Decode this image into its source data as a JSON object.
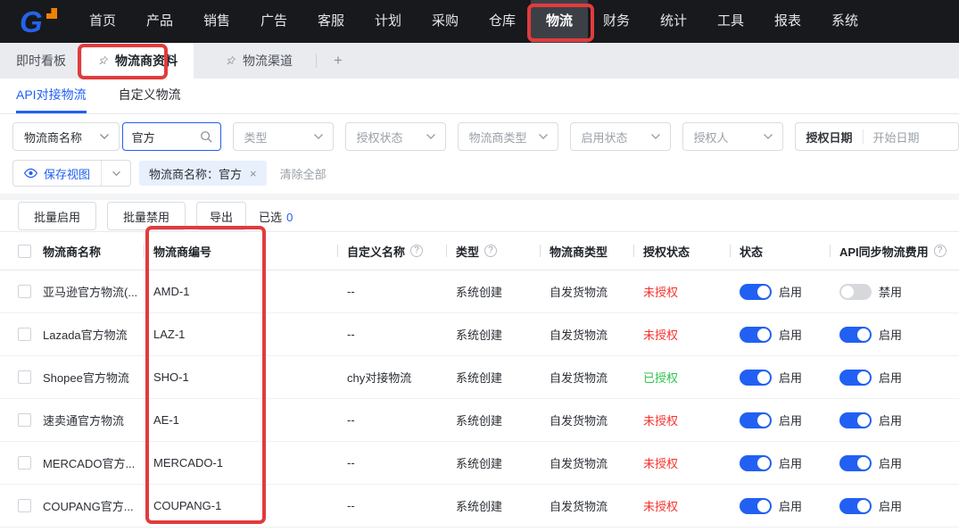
{
  "nav": {
    "logo_text": "G",
    "items": [
      {
        "id": "home",
        "label": "首页",
        "active": false
      },
      {
        "id": "product",
        "label": "产品",
        "active": false
      },
      {
        "id": "sales",
        "label": "销售",
        "active": false
      },
      {
        "id": "ads",
        "label": "广告",
        "active": false
      },
      {
        "id": "service",
        "label": "客服",
        "active": false
      },
      {
        "id": "plan",
        "label": "计划",
        "active": false
      },
      {
        "id": "purchase",
        "label": "采购",
        "active": false
      },
      {
        "id": "warehouse",
        "label": "仓库",
        "active": false
      },
      {
        "id": "logistics",
        "label": "物流",
        "active": true
      },
      {
        "id": "finance",
        "label": "财务",
        "active": false
      },
      {
        "id": "stats",
        "label": "统计",
        "active": false
      },
      {
        "id": "tools",
        "label": "工具",
        "active": false
      },
      {
        "id": "reports",
        "label": "报表",
        "active": false
      },
      {
        "id": "system",
        "label": "系统",
        "active": false
      }
    ]
  },
  "tabs": {
    "items": [
      {
        "id": "dashboard",
        "label": "即时看板",
        "pinned": false,
        "active": false
      },
      {
        "id": "provider-info",
        "label": "物流商资料",
        "pinned": true,
        "active": true
      },
      {
        "id": "channel",
        "label": "物流渠道",
        "pinned": true,
        "active": false
      }
    ],
    "add_label": "+"
  },
  "subtabs": [
    {
      "id": "api-logistics",
      "label": "API对接物流",
      "active": true
    },
    {
      "id": "custom-logistics",
      "label": "自定义物流",
      "active": false
    }
  ],
  "filters": {
    "field_select": "物流商名称",
    "search_value": "官方",
    "selects": [
      {
        "id": "type",
        "placeholder": "类型"
      },
      {
        "id": "auth-status",
        "placeholder": "授权状态"
      },
      {
        "id": "provider-type",
        "placeholder": "物流商类型"
      },
      {
        "id": "enable-status",
        "placeholder": "启用状态"
      },
      {
        "id": "authorizer",
        "placeholder": "授权人"
      }
    ],
    "date_label": "授权日期",
    "date_placeholder": "开始日期",
    "save_view": "保存视图",
    "active_tag": "物流商名称：官方",
    "clear_all": "清除全部"
  },
  "toolbar": {
    "bulk_enable": "批量启用",
    "bulk_disable": "批量禁用",
    "export": "导出",
    "selected_label": "已选",
    "selected_count": "0"
  },
  "table": {
    "columns": [
      {
        "id": "name",
        "label": "物流商名称",
        "help": false
      },
      {
        "id": "code",
        "label": "物流商编号",
        "help": false
      },
      {
        "id": "custom_name",
        "label": "自定义名称",
        "help": true
      },
      {
        "id": "type",
        "label": "类型",
        "help": true
      },
      {
        "id": "provider_type",
        "label": "物流商类型",
        "help": false
      },
      {
        "id": "auth",
        "label": "授权状态",
        "help": false
      },
      {
        "id": "status",
        "label": "状态",
        "help": false
      },
      {
        "id": "api_fee",
        "label": "API同步物流费用",
        "help": true
      }
    ],
    "rows": [
      {
        "name": "亚马逊官方物流(...",
        "code": "AMD-1",
        "custom_name": "--",
        "type": "系统创建",
        "provider_type": "自发货物流",
        "auth": "未授权",
        "auth_state": "unauthorized",
        "status_on": true,
        "status_label": "启用",
        "api_on": false,
        "api_label": "禁用"
      },
      {
        "name": "Lazada官方物流",
        "code": "LAZ-1",
        "custom_name": "--",
        "type": "系统创建",
        "provider_type": "自发货物流",
        "auth": "未授权",
        "auth_state": "unauthorized",
        "status_on": true,
        "status_label": "启用",
        "api_on": true,
        "api_label": "启用"
      },
      {
        "name": "Shopee官方物流",
        "code": "SHO-1",
        "custom_name": "chy对接物流",
        "type": "系统创建",
        "provider_type": "自发货物流",
        "auth": "已授权",
        "auth_state": "authorized",
        "status_on": true,
        "status_label": "启用",
        "api_on": true,
        "api_label": "启用"
      },
      {
        "name": "速卖通官方物流",
        "code": "AE-1",
        "custom_name": "--",
        "type": "系统创建",
        "provider_type": "自发货物流",
        "auth": "未授权",
        "auth_state": "unauthorized",
        "status_on": true,
        "status_label": "启用",
        "api_on": true,
        "api_label": "启用"
      },
      {
        "name": "MERCADO官方...",
        "code": "MERCADO-1",
        "custom_name": "--",
        "type": "系统创建",
        "provider_type": "自发货物流",
        "auth": "未授权",
        "auth_state": "unauthorized",
        "status_on": true,
        "status_label": "启用",
        "api_on": true,
        "api_label": "启用"
      },
      {
        "name": "COUPANG官方...",
        "code": "COUPANG-1",
        "custom_name": "--",
        "type": "系统创建",
        "provider_type": "自发货物流",
        "auth": "未授权",
        "auth_state": "unauthorized",
        "status_on": true,
        "status_label": "启用",
        "api_on": true,
        "api_label": "启用"
      }
    ]
  },
  "colors": {
    "accent_blue": "#2160f2",
    "danger_red": "#f5342f",
    "success_green": "#2fc24d",
    "annotation_red": "#e23b3d",
    "navbar_bg": "#17191d"
  }
}
